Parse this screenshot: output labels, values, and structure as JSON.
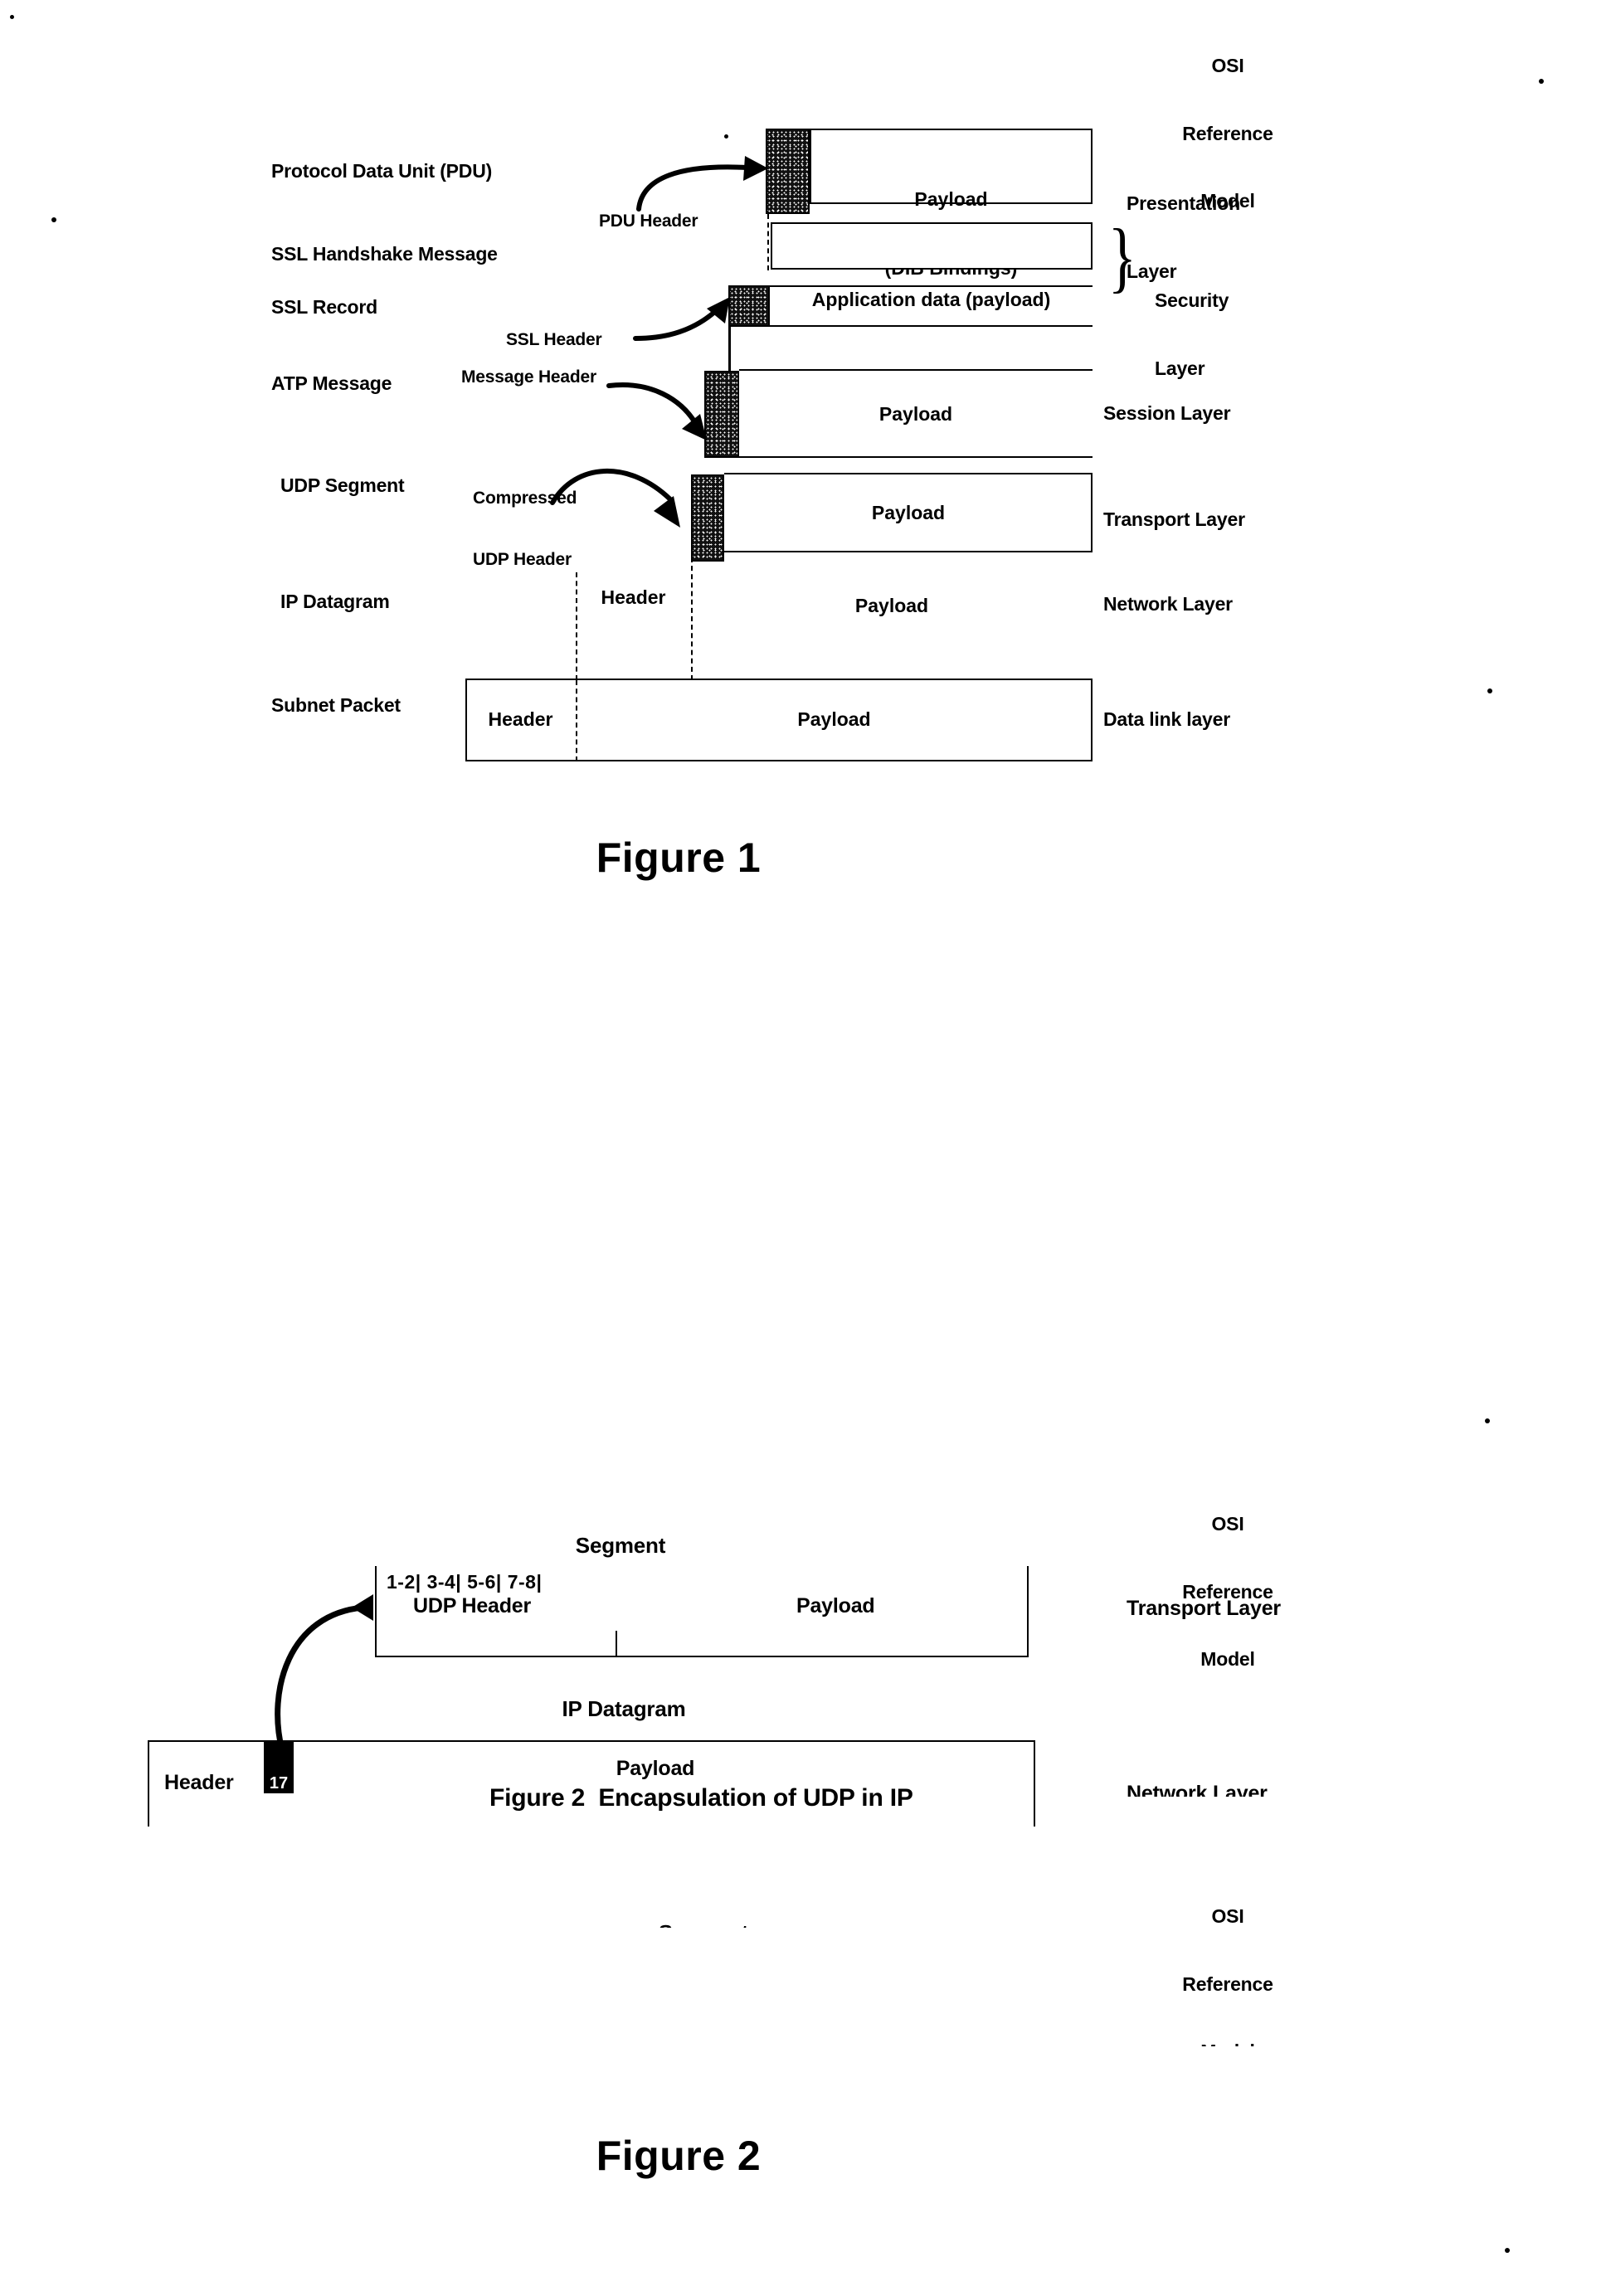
{
  "page": {
    "figure1_caption": "Figure 1",
    "figure2_caption": "Figure 2"
  },
  "figure1": {
    "osi_header": {
      "line1": "OSI",
      "line2": "Reference",
      "line3": "Model"
    },
    "rows": [
      {
        "left_label": "Protocol Data Unit (PDU)",
        "header_callout": "PDU Header",
        "payload_line1": "Payload",
        "payload_line2": "(DIB Bindings)",
        "osi_layer": "Presentation\nLayer"
      },
      {
        "left_label": "SSL Handshake Message",
        "header_callout": "",
        "payload_line1": "",
        "payload_line2": "",
        "osi_layer": ""
      },
      {
        "left_label": "SSL Record",
        "header_callout": "SSL Header",
        "payload_line1": "Application data (payload)",
        "payload_line2": "",
        "osi_layer": ""
      },
      {
        "left_label": "ATP Message",
        "header_callout": "Message Header",
        "payload_line1": "Payload",
        "payload_line2": "",
        "osi_layer": "Session Layer"
      },
      {
        "left_label": "UDP Segment",
        "header_callout": "Compressed\nUDP Header",
        "payload_line1": "Payload",
        "payload_line2": "",
        "osi_layer": "Transport Layer"
      },
      {
        "left_label": "IP Datagram",
        "header_callout": "",
        "header_cell": "Header",
        "payload_line1": "Payload",
        "payload_line2": "",
        "osi_layer": "Network Layer"
      },
      {
        "left_label": "Subnet Packet",
        "header_callout": "",
        "header_cell": "Header",
        "payload_line1": "Payload",
        "payload_line2": "",
        "osi_layer": "Data link layer"
      }
    ],
    "security_bracket_label": "Security\nLayer"
  },
  "figure2": {
    "osi_header": {
      "line1": "OSI",
      "line2": "Reference",
      "line3": "Model"
    },
    "segment_title": "Segment",
    "udp_byte_ruler": "1-2| 3-4| 5-6| 7-8|",
    "udp_header_label": "UDP Header",
    "segment_payload_label": "Payload",
    "transport_layer_label": "Transport Layer",
    "ip_datagram_title": "IP Datagram",
    "ip_header_label": "Header",
    "protocol_number": "17",
    "ip_payload_label": "Payload",
    "inline_caption": "Figure 2  Encapsulation of UDP in IP",
    "network_layer_label": "Network Layer",
    "osi_header2": {
      "line1": "OSI",
      "line2": "Reference",
      "line3": "Model"
    },
    "segment_title2": "Segment"
  },
  "colors": {
    "ink": "#000000",
    "paper": "#ffffff"
  }
}
